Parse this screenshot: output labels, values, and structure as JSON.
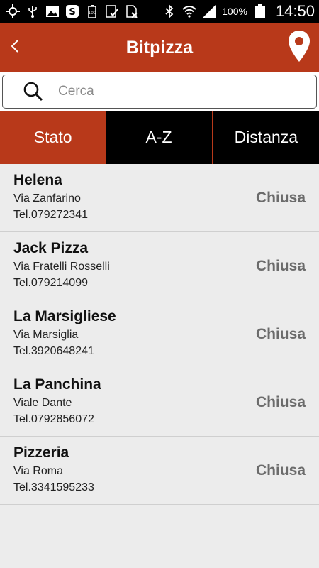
{
  "statusbar": {
    "battery": "100%",
    "time": "14:50",
    "left_icons": [
      "gps-icon",
      "usb-icon",
      "image-icon",
      "shazam-icon",
      "battery-100-icon",
      "checkbox-icon",
      "sim-icon"
    ],
    "right_icons": [
      "bluetooth-icon",
      "wifi-icon",
      "signal-icon",
      "battery-icon"
    ]
  },
  "appbar": {
    "title": "Bitpizza",
    "back_icon": "chevron-left-icon",
    "map_icon": "map-pin-icon",
    "color": "#b8391a"
  },
  "search": {
    "placeholder": "Cerca",
    "value": ""
  },
  "tabs": [
    {
      "label": "Stato",
      "active": true
    },
    {
      "label": "A-Z",
      "active": false
    },
    {
      "label": "Distanza",
      "active": false
    }
  ],
  "pizzerias": [
    {
      "name": "Helena",
      "address": "Via Zanfarino",
      "phone": "Tel.079272341",
      "status": "Chiusa"
    },
    {
      "name": "Jack Pizza",
      "address": "Via Fratelli Rosselli",
      "phone": "Tel.079214099",
      "status": "Chiusa"
    },
    {
      "name": "La Marsigliese",
      "address": "Via Marsiglia",
      "phone": "Tel.3920648241",
      "status": "Chiusa"
    },
    {
      "name": "La Panchina",
      "address": "Viale Dante",
      "phone": "Tel.0792856072",
      "status": "Chiusa"
    },
    {
      "name": "Pizzeria",
      "address": "Via Roma",
      "phone": "Tel.3341595233",
      "status": "Chiusa"
    }
  ]
}
